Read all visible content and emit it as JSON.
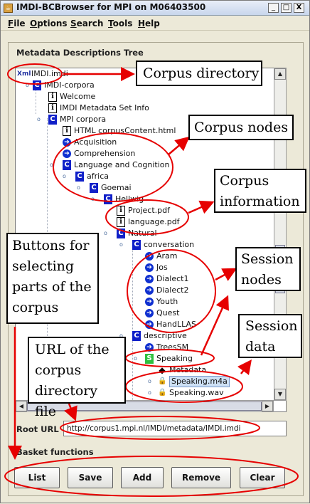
{
  "window": {
    "title": "IMDI-BCBrowser for MPI on M06403500",
    "controls": {
      "minimize": "_",
      "maximize": "□",
      "close": "X"
    }
  },
  "menu": [
    {
      "label": "File",
      "mnemonic": "F",
      "rest": "ile"
    },
    {
      "label": "Options",
      "mnemonic": "O",
      "rest": "ptions"
    },
    {
      "label": "Search",
      "mnemonic": "S",
      "rest": "earch"
    },
    {
      "label": "Tools",
      "mnemonic": "T",
      "rest": "ools"
    },
    {
      "label": "Help",
      "mnemonic": "H",
      "rest": "elp"
    }
  ],
  "tree": {
    "title": "Metadata Descriptions Tree",
    "nodes": [
      {
        "label": "IMDI.imdi",
        "icon": "xml-icon"
      },
      {
        "label": "IMDI-corpora",
        "icon": "corpus-icon"
      },
      {
        "label": "Welcome",
        "icon": "info-icon"
      },
      {
        "label": "IMDI Metadata Set Info",
        "icon": "info-icon"
      },
      {
        "label": "MPI corpora",
        "icon": "corpus-icon"
      },
      {
        "label": "HTML corpusContent.html",
        "icon": "info-icon"
      },
      {
        "label": "Acquisition",
        "icon": "arrow-icon"
      },
      {
        "label": "Comprehension",
        "icon": "arrow-icon"
      },
      {
        "label": "Language and Cognition",
        "icon": "corpus-icon"
      },
      {
        "label": "africa",
        "icon": "corpus-icon"
      },
      {
        "label": "Goemai",
        "icon": "corpus-icon"
      },
      {
        "label": "Hellwig",
        "icon": "corpus-icon"
      },
      {
        "label": "Project.pdf",
        "icon": "info-icon"
      },
      {
        "label": "language.pdf",
        "icon": "info-icon"
      },
      {
        "label": "Natural",
        "icon": "corpus-icon"
      },
      {
        "label": "conversation",
        "icon": "corpus-icon"
      },
      {
        "label": "Aram",
        "icon": "arrow-icon"
      },
      {
        "label": "Jos",
        "icon": "arrow-icon"
      },
      {
        "label": "Dialect1",
        "icon": "arrow-icon"
      },
      {
        "label": "Dialect2",
        "icon": "arrow-icon"
      },
      {
        "label": "Youth",
        "icon": "arrow-icon"
      },
      {
        "label": "Quest",
        "icon": "arrow-icon"
      },
      {
        "label": "HandLLAS",
        "icon": "arrow-icon"
      },
      {
        "label": "descriptive",
        "icon": "corpus-icon"
      },
      {
        "label": "TreesSM",
        "icon": "arrow-icon"
      },
      {
        "label": "Speaking",
        "icon": "session-icon"
      },
      {
        "label": "Metadata",
        "icon": "metadata-icon"
      },
      {
        "label": "Speaking.m4a",
        "icon": "lock-icon",
        "selected": true
      },
      {
        "label": "Speaking.wav",
        "icon": "lock-icon"
      }
    ]
  },
  "root_url": {
    "label": "Root URL",
    "value": "http://corpus1.mpi.nl/IMDI/metadata/IMDI.imdi"
  },
  "basket": {
    "label": "Basket functions",
    "buttons": [
      "List",
      "Save",
      "Add",
      "Remove",
      "Clear"
    ]
  },
  "annotations": {
    "corpus_directory": "Corpus directory",
    "corpus_nodes": "Corpus nodes",
    "corpus_information": "Corpus information",
    "session_nodes": "Session nodes",
    "session_data": "Session data",
    "buttons_note": "Buttons for selecting parts of the corpus",
    "url_note": "URL of the corpus directory file"
  },
  "colors": {
    "annotation_red": "#e60000",
    "corpus_icon_blue": "#1020c8",
    "session_icon_green": "#2ec040",
    "selection_blue": "#cde0f4"
  }
}
